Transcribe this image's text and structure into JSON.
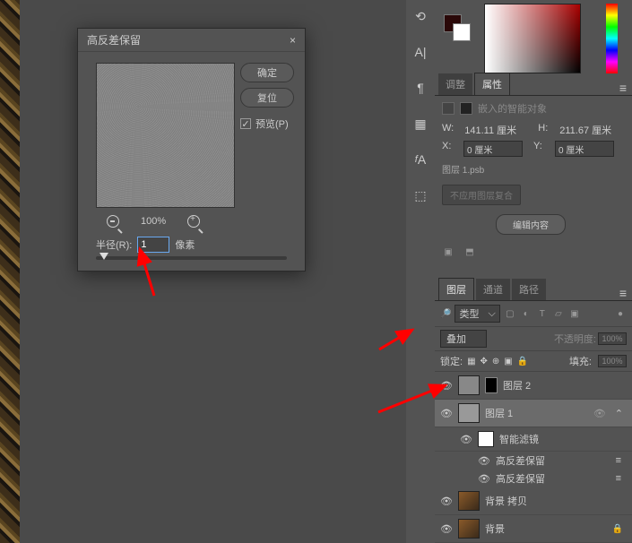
{
  "dialog": {
    "title": "高反差保留",
    "ok": "确定",
    "reset": "复位",
    "preview": "预览(P)",
    "preview_checked": "✓",
    "zoom_pct": "100%",
    "radius_label": "半径(R):",
    "radius_value": "1",
    "radius_unit": "像素"
  },
  "properties": {
    "tab_adjust": "调整",
    "tab_props": "属性",
    "embedded": "嵌入的智能对象",
    "w_label": "W:",
    "w_value": "141.11 厘米",
    "h_label": "H:",
    "h_value": "211.67 厘米",
    "x_label": "X:",
    "x_value": "0 厘米",
    "y_label": "Y:",
    "y_value": "0 厘米",
    "layer_file": "图层 1.psb",
    "no_comp": "不应用图层复合",
    "edit_content": "编辑内容"
  },
  "layers": {
    "tab_layers": "图层",
    "tab_channels": "通道",
    "tab_paths": "路径",
    "kind": "类型",
    "blend_mode": "叠加",
    "opacity_label": "不透明度:",
    "opacity_value": "100%",
    "lock_label": "锁定:",
    "fill_label": "填充:",
    "fill_value": "100%",
    "layer2": "图层 2",
    "layer1": "图层 1",
    "smart_filters": "智能滤镜",
    "hp1": "高反差保留",
    "hp2": "高反差保留",
    "bg_copy": "背景 拷贝",
    "bg": "背景"
  }
}
